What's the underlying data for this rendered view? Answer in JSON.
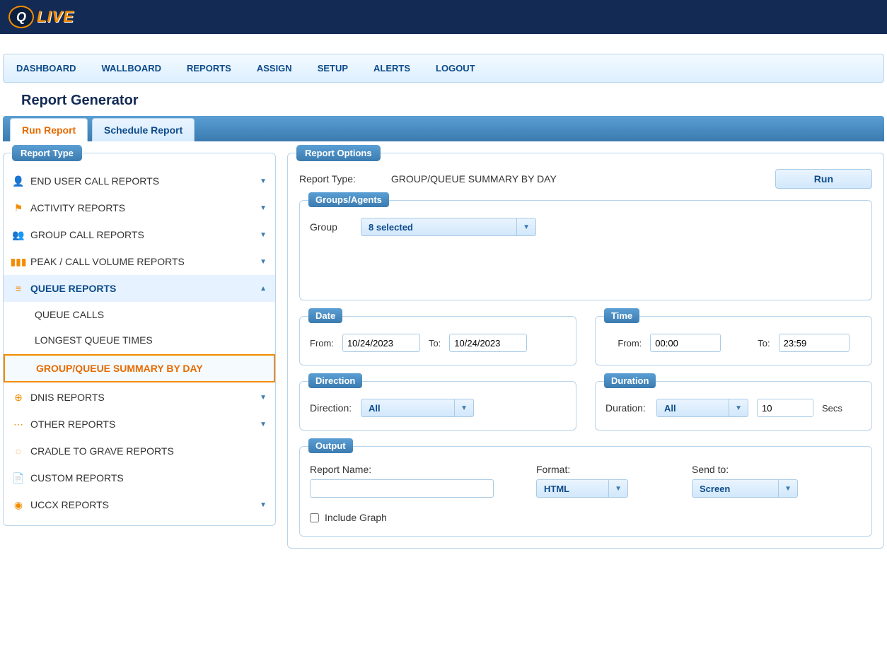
{
  "logo": {
    "badge": "Q",
    "text": "LIVE"
  },
  "nav": [
    "DASHBOARD",
    "WALLBOARD",
    "REPORTS",
    "ASSIGN",
    "SETUP",
    "ALERTS",
    "LOGOUT"
  ],
  "page_title": "Report Generator",
  "tabs": {
    "run": "Run Report",
    "schedule": "Schedule Report"
  },
  "sidebar": {
    "title": "Report Type",
    "cats": [
      {
        "icon": "👤",
        "label": "END USER CALL REPORTS"
      },
      {
        "icon": "⚑",
        "label": "ACTIVITY REPORTS"
      },
      {
        "icon": "👥",
        "label": "GROUP CALL REPORTS"
      },
      {
        "icon": "▮▮▮",
        "label": "PEAK / CALL VOLUME REPORTS"
      },
      {
        "icon": "≡",
        "label": "QUEUE REPORTS"
      },
      {
        "icon": "⊕",
        "label": "DNIS REPORTS"
      },
      {
        "icon": "⋯",
        "label": "OTHER REPORTS"
      },
      {
        "icon": "◌",
        "label": "CRADLE TO GRAVE REPORTS"
      },
      {
        "icon": "📄",
        "label": "CUSTOM REPORTS"
      },
      {
        "icon": "◉",
        "label": "UCCX REPORTS"
      }
    ],
    "subs": [
      "QUEUE CALLS",
      "LONGEST QUEUE TIMES",
      "GROUP/QUEUE SUMMARY BY DAY"
    ]
  },
  "options": {
    "title": "Report Options",
    "report_type_label": "Report Type:",
    "report_type_value": "GROUP/QUEUE SUMMARY BY DAY",
    "run": "Run",
    "groups_agents": {
      "title": "Groups/Agents",
      "group_label": "Group",
      "group_value": "8 selected"
    },
    "date": {
      "title": "Date",
      "from_label": "From:",
      "from_value": "10/24/2023",
      "to_label": "To:",
      "to_value": "10/24/2023"
    },
    "time": {
      "title": "Time",
      "from_label": "From:",
      "from_value": "00:00",
      "to_label": "To:",
      "to_value": "23:59"
    },
    "direction": {
      "title": "Direction",
      "label": "Direction:",
      "value": "All"
    },
    "duration": {
      "title": "Duration",
      "label": "Duration:",
      "value": "All",
      "secs_value": "10",
      "secs_label": "Secs"
    },
    "output": {
      "title": "Output",
      "report_name_label": "Report Name:",
      "report_name_value": "",
      "format_label": "Format:",
      "format_value": "HTML",
      "sendto_label": "Send to:",
      "sendto_value": "Screen",
      "include_graph": "Include Graph"
    }
  }
}
